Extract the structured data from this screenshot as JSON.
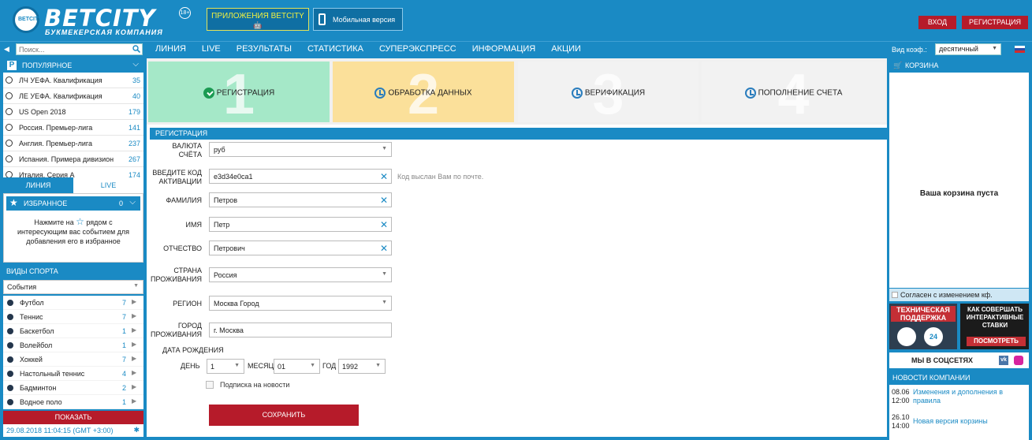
{
  "header": {
    "logo_text": "BETCITY",
    "logo_sub": "БУКМЕКЕРСКАЯ КОМПАНИЯ",
    "age_badge": "18+",
    "apps_label": "ПРИЛОЖЕНИЯ BETCITY",
    "apps_os": "🤖",
    "mobile_label": "Мобильная версия",
    "login": "ВХОД",
    "register": "РЕГИСТРАЦИЯ"
  },
  "nav": {
    "search_placeholder": "Поиск...",
    "items": [
      "ЛИНИЯ",
      "LIVE",
      "РЕЗУЛЬТАТЫ",
      "СТАТИСТИКА",
      "СУПЕРЭКСПРЕСС",
      "ИНФОРМАЦИЯ",
      "АКЦИИ"
    ],
    "coef_label": "Вид коэф.:",
    "coef_value": "десятичный"
  },
  "sidebar": {
    "popular_title": "ПОПУЛЯРНОЕ",
    "popular": [
      {
        "name": "ЛЧ УЕФА. Квалификация",
        "count": "35"
      },
      {
        "name": "ЛЕ УЕФА. Квалификация",
        "count": "40"
      },
      {
        "name": "US Open 2018",
        "count": "179"
      },
      {
        "name": "Россия. Премьер-лига",
        "count": "141"
      },
      {
        "name": "Англия. Премьер-лига",
        "count": "237"
      },
      {
        "name": "Испания. Примера дивизион",
        "count": "267"
      },
      {
        "name": "Италия. Серия А",
        "count": "174"
      }
    ],
    "tab_line": "ЛИНИЯ",
    "tab_live": "LIVE",
    "fav_title": "ИЗБРАННОЕ",
    "fav_count": "0",
    "fav_text_1": "Нажмите на",
    "fav_text_2": "рядом с",
    "fav_text_3": "интересующим вас событием для",
    "fav_text_4": "добавления его в избранное",
    "sports_title": "ВИДЫ СПОРТА",
    "events_select": "События",
    "sports": [
      {
        "name": "Футбол",
        "count": "7"
      },
      {
        "name": "Теннис",
        "count": "7"
      },
      {
        "name": "Баскетбол",
        "count": "1"
      },
      {
        "name": "Волейбол",
        "count": "1"
      },
      {
        "name": "Хоккей",
        "count": "7"
      },
      {
        "name": "Настольный теннис",
        "count": "4"
      },
      {
        "name": "Бадминтон",
        "count": "2"
      },
      {
        "name": "Водное поло",
        "count": "1"
      }
    ],
    "show_button": "ПОКАЗАТЬ",
    "datetime": "29.08.2018 11:04:15 (GMT +3:00)"
  },
  "steps": [
    {
      "num": "1",
      "label": "РЕГИСТРАЦИЯ"
    },
    {
      "num": "2",
      "label": "ОБРАБОТКА ДАННЫХ"
    },
    {
      "num": "3",
      "label": "ВЕРИФИКАЦИЯ"
    },
    {
      "num": "4",
      "label": "ПОПОЛНЕНИЕ СЧЕТА"
    }
  ],
  "form": {
    "title": "РЕГИСТРАЦИЯ",
    "currency_label_1": "ВАЛЮТА",
    "currency_label_2": "СЧЁТА",
    "currency_value": "руб",
    "code_label_1": "ВВЕДИТЕ КОД",
    "code_label_2": "АКТИВАЦИИ",
    "code_value": "e3d34e0ca1",
    "code_hint": "Код выслан Вам по почте.",
    "surname_label": "ФАМИЛИЯ",
    "surname_value": "Петров",
    "name_label": "ИМЯ",
    "name_value": "Петр",
    "patronymic_label": "ОТЧЕСТВО",
    "patronymic_value": "Петрович",
    "country_label_1": "СТРАНА",
    "country_label_2": "ПРОЖИВАНИЯ",
    "country_value": "Россия",
    "region_label": "РЕГИОН",
    "region_value": "Москва Город",
    "city_label_1": "ГОРОД",
    "city_label_2": "ПРОЖИВАНИЯ",
    "city_value": "г. Москва",
    "dob_label": "ДАТА РОЖДЕНИЯ",
    "day_label": "ДЕНЬ",
    "day_value": "1",
    "month_label": "МЕСЯЦ",
    "month_value": "01",
    "year_label": "ГОД",
    "year_value": "1992",
    "subscribe_label": "Подписка на новости",
    "save_button": "СОХРАНИТЬ"
  },
  "right": {
    "cart_title": "КОРЗИНА",
    "cart_empty": "Ваша корзина пуста",
    "agree_label": "Согласен с изменением кф.",
    "support_title": "ТЕХНИЧЕСКАЯ ПОДДЕРЖКА",
    "support_24": "24",
    "bets_title": "КАК СОВЕРШАТЬ ИНТЕРАКТИВНЫЕ СТАВКИ",
    "bets_button": "ПОСМОТРЕТЬ",
    "social_title": "МЫ В СОЦСЕТЯХ",
    "vk": "vk",
    "news_title": "НОВОСТИ КОМПАНИИ",
    "news": [
      {
        "date": "08.06",
        "time": "12:00",
        "title": "Изменения и дополнения в правила"
      },
      {
        "date": "26.10",
        "time": "14:00",
        "title": "Новая версия корзины"
      }
    ]
  },
  "colors": {
    "brand_blue": "#1a8ac4",
    "accent_red": "#b61b2a",
    "step_done": "#a5e8c8",
    "step_active": "#fbe09a"
  }
}
